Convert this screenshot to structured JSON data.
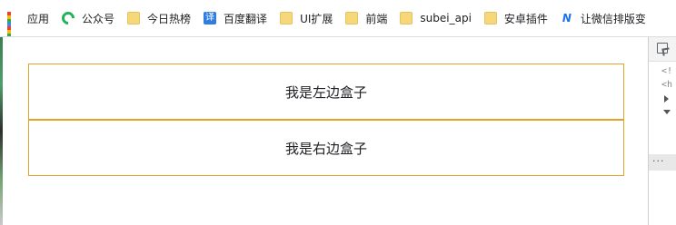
{
  "bookmarks": [
    {
      "label": "应用",
      "icon": "apps-grid-icon"
    },
    {
      "label": "公众号",
      "icon": "wechat-icon"
    },
    {
      "label": "今日热榜",
      "icon": "folder-icon"
    },
    {
      "label": "百度翻译",
      "icon": "translate-icon"
    },
    {
      "label": "UI扩展",
      "icon": "folder-icon"
    },
    {
      "label": "前端",
      "icon": "folder-icon"
    },
    {
      "label": "subei_api",
      "icon": "folder-icon"
    },
    {
      "label": "安卓插件",
      "icon": "folder-icon"
    },
    {
      "label": "让微信排版变",
      "icon": "wechat-editor-icon"
    }
  ],
  "icons": {
    "translate_glyph": "译",
    "brand_glyph": "N"
  },
  "boxes": {
    "left_label": "我是左边盒子",
    "right_label": "我是右边盒子"
  },
  "devtools": {
    "lines": [
      "<!",
      "<h"
    ],
    "split_handle": "···"
  },
  "colors": {
    "box_border": "#e0a526",
    "folder": "#f6d77a",
    "wechat_green": "#21b35b",
    "translate_blue": "#2f7de1"
  }
}
